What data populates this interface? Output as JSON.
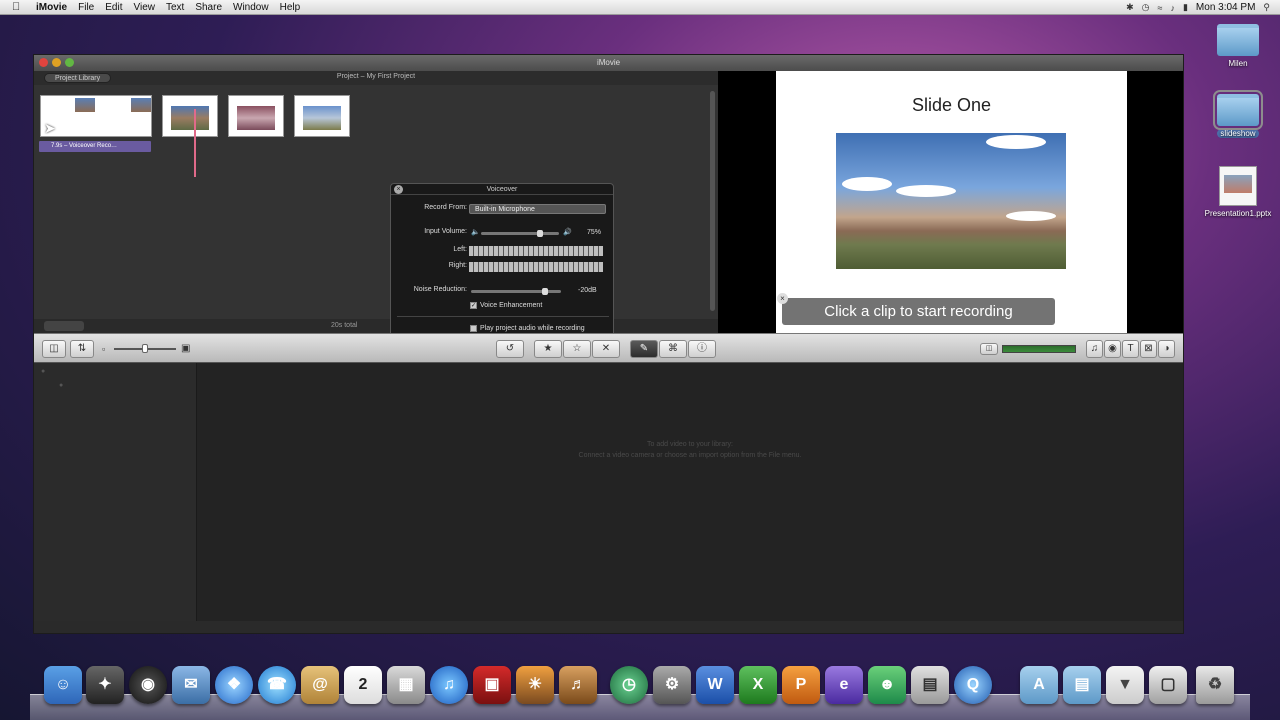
{
  "menubar": {
    "app": "iMovie",
    "items": [
      "File",
      "Edit",
      "View",
      "Text",
      "Share",
      "Window",
      "Help"
    ],
    "clock": "Mon 3:04 PM"
  },
  "desktop": {
    "icons": [
      {
        "label": "Milen",
        "kind": "folder"
      },
      {
        "label": "slideshow",
        "kind": "folder"
      },
      {
        "label": "Presentation1.pptx",
        "kind": "document"
      }
    ]
  },
  "window": {
    "title": "iMovie",
    "project_library_button": "Project Library",
    "project_title": "Project – My First Project",
    "clip_label": "7.9s – Voiceover Reco…",
    "total": "20s total"
  },
  "voiceover": {
    "title": "Voiceover",
    "record_from_label": "Record From:",
    "record_from_value": "Built-in Microphone",
    "input_volume_label": "Input Volume:",
    "input_volume_value": "75%",
    "left_label": "Left:",
    "right_label": "Right:",
    "noise_reduction_label": "Noise Reduction:",
    "noise_reduction_value": "-20dB",
    "voice_enhancement_label": "Voice Enhancement",
    "play_audio_label": "Play project audio while recording",
    "input_volume_level": 0.75,
    "noise_reduction_level": 0.82
  },
  "viewer": {
    "slide_title": "Slide One",
    "hint": "Click a clip to start recording"
  },
  "event_library": {
    "empty_line1": "To add video to your library:",
    "empty_line2": "Connect a video camera or choose an import option from the File menu."
  },
  "colors": {
    "accent": "#6a5ba0",
    "playhead": "#e06a8a"
  }
}
